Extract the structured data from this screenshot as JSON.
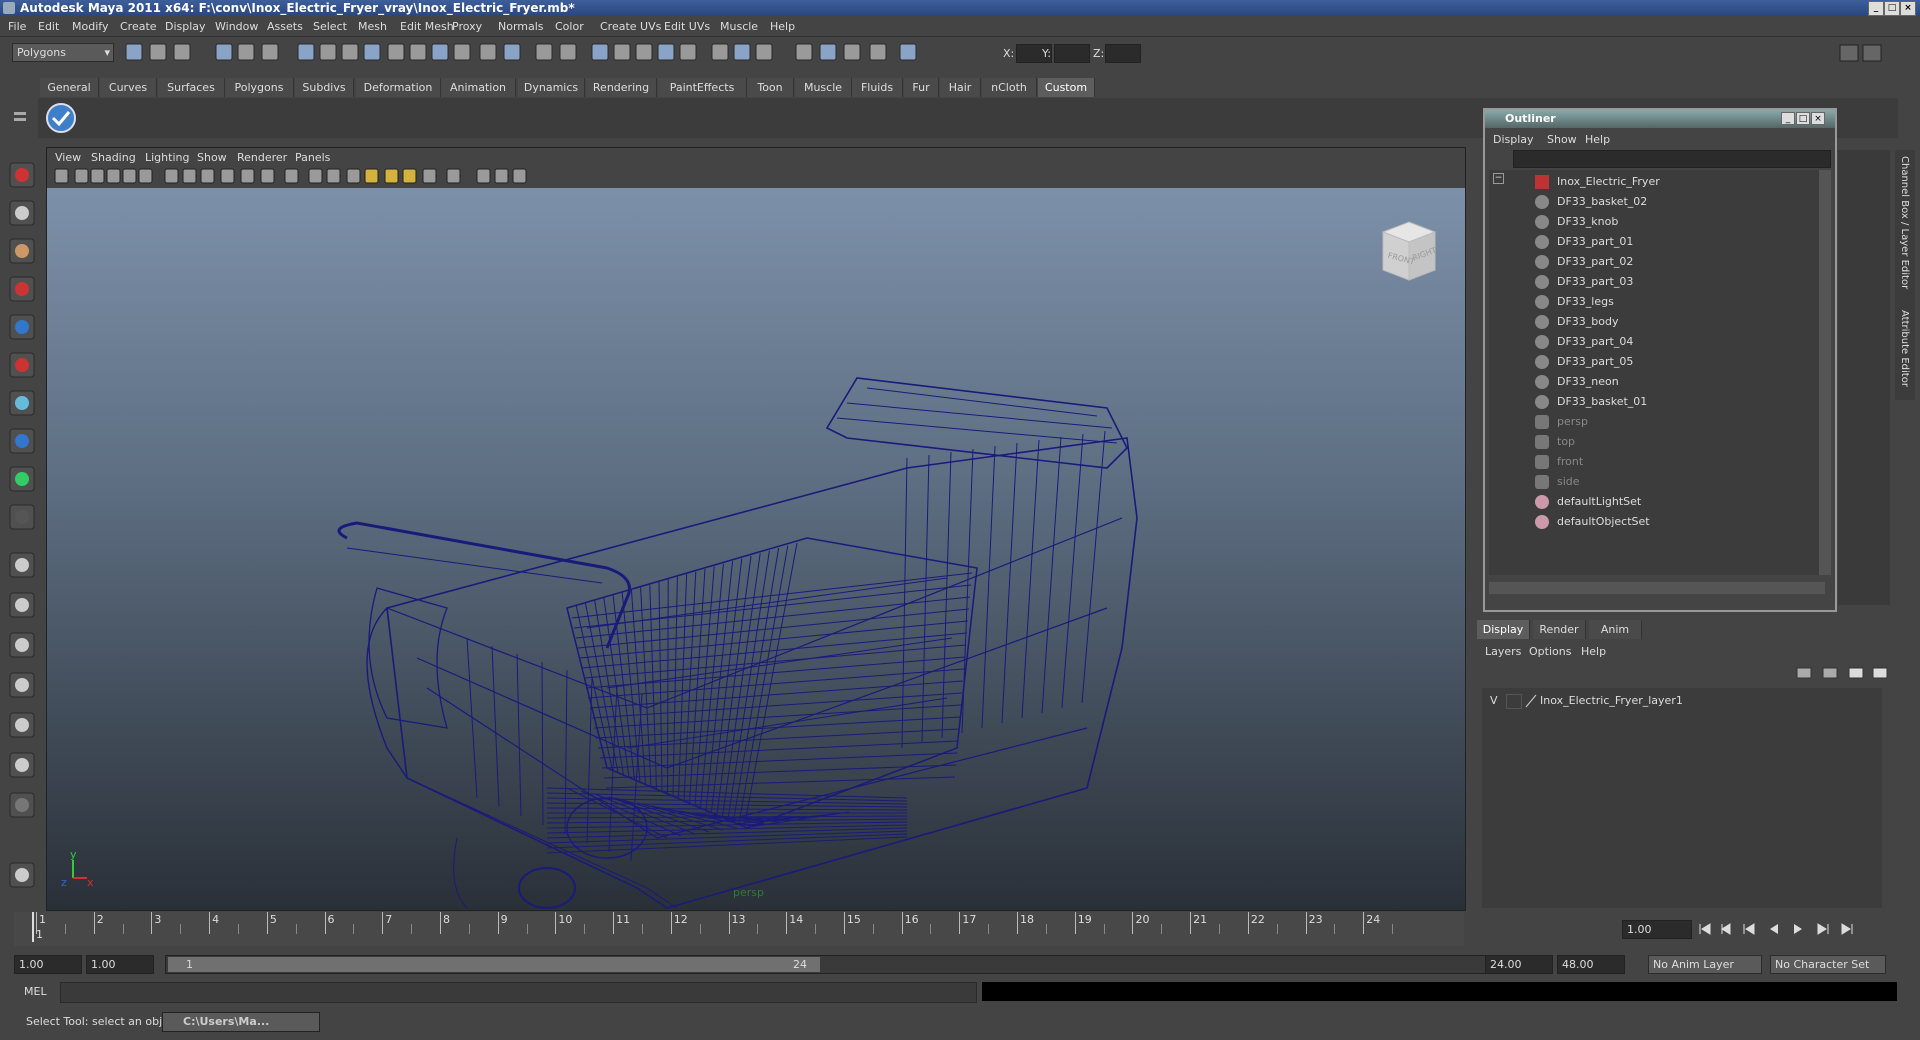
{
  "window": {
    "title": "Autodesk Maya 2011 x64: F:\\conv\\Inox_Electric_Fryer_vray\\Inox_Electric_Fryer.mb*"
  },
  "menubar": [
    "File",
    "Edit",
    "Modify",
    "Create",
    "Display",
    "Window",
    "Assets",
    "Select",
    "Mesh",
    "Edit Mesh",
    "Proxy",
    "Normals",
    "Color",
    "Create UVs",
    "Edit UVs",
    "Muscle",
    "Help"
  ],
  "status": {
    "mode": "Polygons",
    "x_label": "X:",
    "y_label": "Y:",
    "z_label": "Z:"
  },
  "shelf_tabs": [
    "General",
    "Curves",
    "Surfaces",
    "Polygons",
    "Subdivs",
    "Deformation",
    "Animation",
    "Dynamics",
    "Rendering",
    "PaintEffects",
    "Toon",
    "Muscle",
    "Fluids",
    "Fur",
    "Hair",
    "nCloth",
    "Custom"
  ],
  "active_shelf": "Custom",
  "viewport": {
    "menu": [
      "View",
      "Shading",
      "Lighting",
      "Show",
      "Renderer",
      "Panels"
    ],
    "camera_label": "persp",
    "cube_front": "FRONT",
    "cube_right": "RIGHT",
    "axis_y": "y",
    "axis_x": "x",
    "axis_z": "z"
  },
  "outliner": {
    "title": "Outliner",
    "menu": [
      "Display",
      "Show",
      "Help"
    ],
    "root": "Inox_Electric_Fryer",
    "children": [
      "DF33_basket_02",
      "DF33_knob",
      "DF33_part_01",
      "DF33_part_02",
      "DF33_part_03",
      "DF33_legs",
      "DF33_body",
      "DF33_part_04",
      "DF33_part_05",
      "DF33_neon",
      "DF33_basket_01"
    ],
    "cameras": [
      "persp",
      "top",
      "front",
      "side"
    ],
    "sets": [
      "defaultLightSet",
      "defaultObjectSet"
    ]
  },
  "layer_editor": {
    "tabs": [
      "Display",
      "Render",
      "Anim"
    ],
    "active_tab": "Display",
    "menu": [
      "Layers",
      "Options",
      "Help"
    ],
    "layer_visibility": "V",
    "layer_name": "Inox_Electric_Fryer_layer1"
  },
  "side_tabs": [
    "Channel Box / Layer Editor",
    "Attribute Editor"
  ],
  "timeline": {
    "ticks": [
      1,
      2,
      3,
      4,
      5,
      6,
      7,
      8,
      9,
      10,
      11,
      12,
      13,
      14,
      15,
      16,
      17,
      18,
      19,
      20,
      21,
      22,
      23,
      24
    ],
    "current_frame_display": "1",
    "current_time": "1.00"
  },
  "range": {
    "start": "1.00",
    "playback_start": "1.00",
    "slider_start": "1",
    "slider_end": "24",
    "playback_end": "24.00",
    "end": "48.00",
    "anim_layer": "No Anim Layer",
    "character_set": "No Character Set"
  },
  "cmdline": {
    "label": "MEL"
  },
  "helpline": {
    "text": "Select Tool: select an object",
    "taskbar": "C:\\Users\\Ma..."
  }
}
